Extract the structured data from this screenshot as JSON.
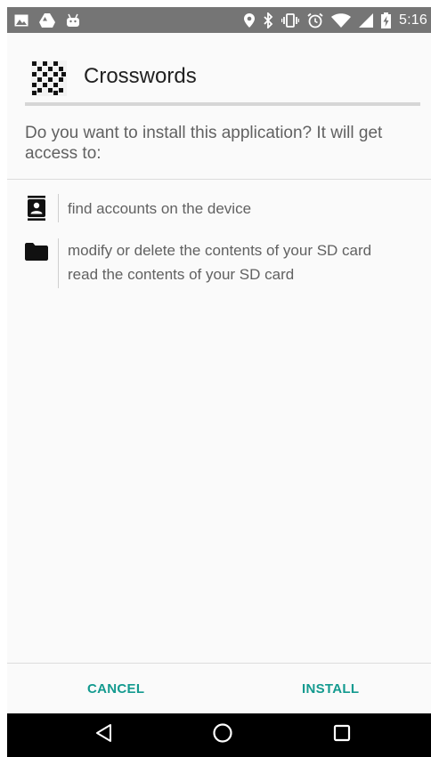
{
  "status_bar": {
    "time": "5:16",
    "left_icons": [
      "gallery-icon",
      "drive-icon",
      "android-icon"
    ],
    "right_icons": [
      "location-icon",
      "bluetooth-icon",
      "vibrate-icon",
      "alarm-icon",
      "wifi-icon",
      "signal-icon",
      "battery-charging-icon"
    ]
  },
  "header": {
    "app_name": "Crosswords",
    "app_icon": "crossword-grid-icon"
  },
  "prompt": {
    "text": "Do you want to install this application? It will get access to:"
  },
  "permissions": [
    {
      "icon": "contacts-icon",
      "lines": [
        "find accounts on the device"
      ]
    },
    {
      "icon": "folder-icon",
      "lines": [
        "modify or delete the contents of your SD card",
        "read the contents of your SD card"
      ]
    }
  ],
  "actions": {
    "cancel_label": "CANCEL",
    "install_label": "INSTALL"
  },
  "nav_bar": {
    "icons": [
      "back-icon",
      "home-icon",
      "recents-icon"
    ]
  },
  "colors": {
    "status_bar": "#757575",
    "accent": "#139a8f",
    "nav_bar": "#000000",
    "background": "#fafafa"
  }
}
